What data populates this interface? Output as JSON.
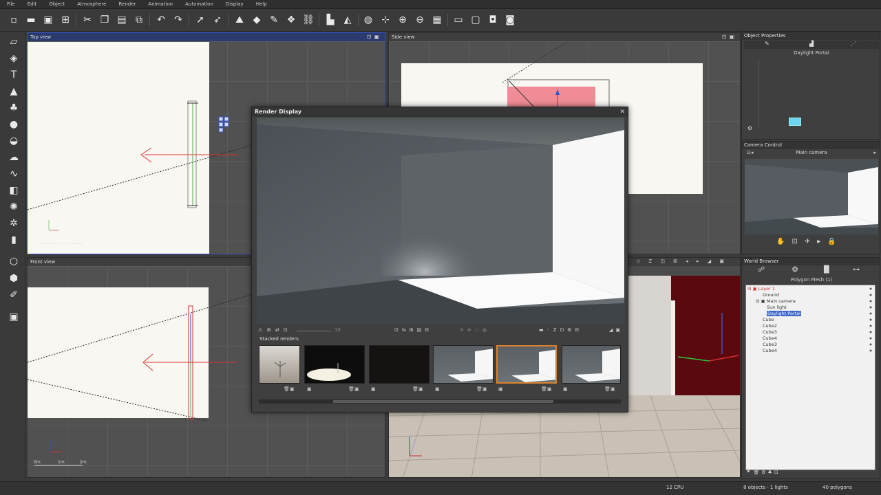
{
  "menu": [
    "File",
    "Edit",
    "Object",
    "Atmosphere",
    "Render",
    "Animation",
    "Automation",
    "Display",
    "Help"
  ],
  "viewports": {
    "top_view": "Top view",
    "side_view": "Side view",
    "front_view": "Front view",
    "scale_labels": [
      "0m",
      "1m",
      "2m"
    ]
  },
  "render_display": {
    "title": "Render Display",
    "stacked_label": "Stacked renders",
    "zoom_value": "10",
    "thumbnail_count": 6,
    "selected_thumbnail": 5
  },
  "object_properties": {
    "title": "Object Properties",
    "object_name": "Daylight Portal"
  },
  "camera_control": {
    "title": "Camera Control",
    "camera_name": "Main camera"
  },
  "world_browser": {
    "title": "World Browser",
    "subtitle": "Polygon Mesh (1)",
    "items": [
      {
        "label": "Layer 1",
        "type": "layer"
      },
      {
        "label": "Ground",
        "type": "item"
      },
      {
        "label": "Main camera",
        "type": "item"
      },
      {
        "label": "Sun light",
        "type": "item"
      },
      {
        "label": "Daylight Portal",
        "type": "selected"
      },
      {
        "label": "Cube",
        "type": "item"
      },
      {
        "label": "Cube2",
        "type": "item"
      },
      {
        "label": "Cube3",
        "type": "item"
      },
      {
        "label": "Cube4",
        "type": "item"
      },
      {
        "label": "Cube3",
        "type": "item"
      },
      {
        "label": "Cube4",
        "type": "item"
      }
    ]
  },
  "status": {
    "cpu": "12 CPU",
    "objects": "8 objects - 1 lights",
    "polygons": "40 polygons"
  },
  "colors": {
    "accent_selection": "#d9822b",
    "active_title": "#2b3b6e",
    "wall_red": "#5a0a0f"
  }
}
